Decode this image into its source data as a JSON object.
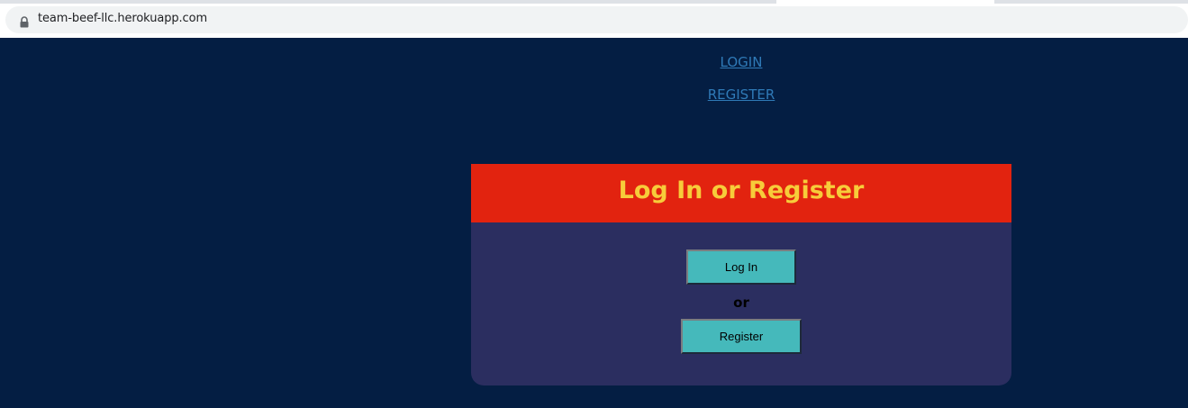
{
  "browser": {
    "url": "team-beef-llc.herokuapp.com",
    "lock_icon": "lock-icon"
  },
  "nav": {
    "login_label": "LOGIN",
    "register_label": "REGISTER"
  },
  "card": {
    "title": "Log In or Register",
    "login_button": "Log In",
    "separator": "or",
    "register_button": "Register"
  },
  "colors": {
    "page_background": "#041e43",
    "card_background": "#2b2e60",
    "header_background": "#e2230f",
    "title_color": "#f7cc3a",
    "button_background": "#45b9bb",
    "link_color": "#2f7ab7"
  }
}
